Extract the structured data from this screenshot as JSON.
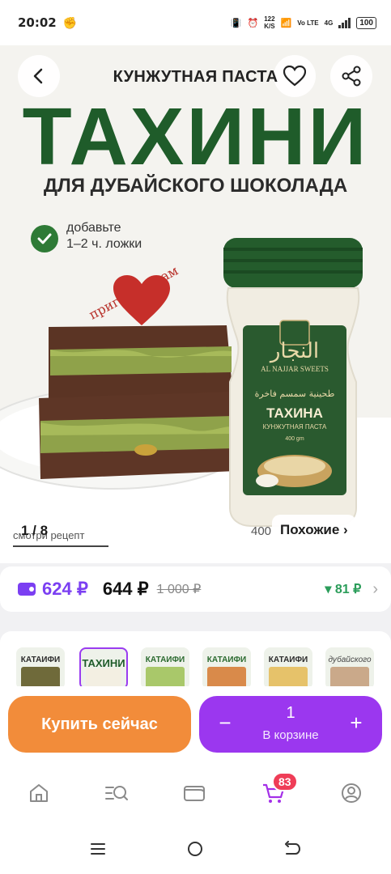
{
  "status_bar": {
    "time": "20:02",
    "network_speed": "122",
    "network_unit": "K/S",
    "volte": "Vo LTE",
    "network_type": "4G",
    "battery": "100"
  },
  "hero": {
    "kicker": "КУНЖУТНАЯ ПАСТА",
    "title": "ТАХИНИ",
    "subtitle": "ДЛЯ ДУБАЙСКОГО ШОКОЛАДА",
    "hint": "добавьте\n1–2 ч. ложки",
    "cook_label": "приготовь сам",
    "jar_brand_lat": "AL NAJJAR SWEETS",
    "jar_name": "ТАХИНА",
    "jar_sub": "КУНЖУТНАЯ ПАСТА",
    "jar_weight": "400 gm",
    "counter": "1 / 8",
    "recipe_link": "смотри рецепт",
    "weight_badge": "400",
    "similar_label": "Похожие ›"
  },
  "price": {
    "card_price": "624 ₽",
    "regular_price": "644 ₽",
    "old_price": "1 000 ₽",
    "cashback": "▾ 81 ₽"
  },
  "variants": [
    {
      "label": "КАТАИФИ",
      "color": "#2b2b2b",
      "img": "#6f6a3a"
    },
    {
      "label": "ТАХИНИ",
      "color": "#1f5c2a",
      "img": "#f3efe2"
    },
    {
      "label": "КАТАИФИ",
      "color": "#2b6a2f",
      "img": "#a9c86a"
    },
    {
      "label": "КАТАИФИ",
      "color": "#2b6a2f",
      "img": "#d98a4a"
    },
    {
      "label": "КАТАИФИ",
      "color": "#2b2b2b",
      "img": "#e6c26a"
    },
    {
      "label": "дубайского",
      "color": "#444444",
      "img": "#caa98a"
    }
  ],
  "buy": {
    "buy_now": "Купить сейчас",
    "minus": "−",
    "plus": "+",
    "quantity": "1",
    "in_cart": "В корзине"
  },
  "tabs": {
    "cart_badge": "83"
  },
  "colors": {
    "accent_purple": "#9b37ef",
    "accent_orange": "#f28c3a",
    "title_green": "#1f5c2a",
    "badge_red": "#ef3d57"
  }
}
